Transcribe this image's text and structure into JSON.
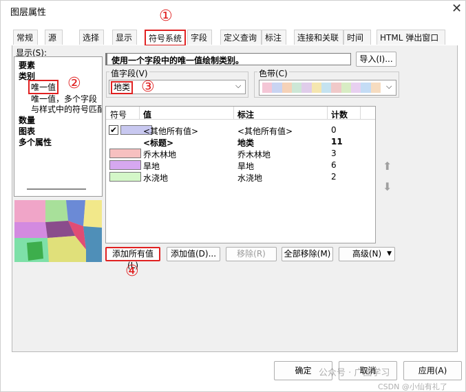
{
  "window": {
    "title": "图层属性",
    "close_glyph": "✕"
  },
  "tabs": [
    {
      "label": "常规"
    },
    {
      "label": "源"
    },
    {
      "label": "选择"
    },
    {
      "label": "显示"
    },
    {
      "label": "符号系统"
    },
    {
      "label": "字段"
    },
    {
      "label": "定义查询"
    },
    {
      "label": "标注"
    },
    {
      "label": "连接和关联"
    },
    {
      "label": "时间"
    },
    {
      "label": "HTML 弹出窗口"
    }
  ],
  "show_label": "显示(S):",
  "tree": [
    {
      "label": "要素"
    },
    {
      "label": "类别"
    },
    {
      "label": "唯一值"
    },
    {
      "label": "唯一值，多个字段"
    },
    {
      "label": "与样式中的符号匹配"
    },
    {
      "label": "数量"
    },
    {
      "label": "图表"
    },
    {
      "label": "多个属性"
    }
  ],
  "description": "使用一个字段中的唯一值绘制类别。",
  "import_button": "导入(I)...",
  "value_field": {
    "label": "值字段(V)",
    "value": "地类"
  },
  "color_ramp": {
    "label": "色带(C)",
    "colors": [
      "#f4c6d6",
      "#c9d4f2",
      "#f5d2b8",
      "#cde7d6",
      "#e0cdea",
      "#f5e6b0",
      "#c5e3f0",
      "#f0c9c9",
      "#d8ecc4",
      "#e8d0f0",
      "#c4dcf5",
      "#f6dcc0"
    ]
  },
  "table": {
    "headers": [
      "符号",
      "值",
      "标注",
      "计数"
    ],
    "rows": [
      {
        "checkbox": true,
        "swatch": "#c8c8f0",
        "value": "<其他所有值>",
        "label": "<其他所有值>",
        "count": "0",
        "bold": false
      },
      {
        "checkbox": false,
        "swatch": "",
        "value": "<标题>",
        "label": "地类",
        "count": "11",
        "bold": true
      },
      {
        "checkbox": false,
        "swatch": "#f7c0c0",
        "value": "乔木林地",
        "label": "乔木林地",
        "count": "3",
        "bold": false
      },
      {
        "checkbox": false,
        "swatch": "#d6a8f0",
        "value": "旱地",
        "label": "旱地",
        "count": "6",
        "bold": false
      },
      {
        "checkbox": false,
        "swatch": "#d4f7c8",
        "value": "水浇地",
        "label": "水浇地",
        "count": "2",
        "bold": false
      }
    ]
  },
  "buttons": {
    "add_all": "添加所有值(L)",
    "add_values": "添加值(D)...",
    "remove": "移除(R)",
    "remove_all": "全部移除(M)",
    "advanced": "高级(N)"
  },
  "footer": {
    "ok": "确定",
    "cancel": "取消",
    "apply": "应用(A)"
  },
  "watermark": {
    "text1": "公众号 · 广图学习",
    "text2": "CSDN @小仙有礼了"
  },
  "annotations": [
    "①",
    "②",
    "③",
    "④"
  ],
  "colors": {
    "highlight": "#e02020",
    "panel_bg": "#f0f0f0"
  }
}
